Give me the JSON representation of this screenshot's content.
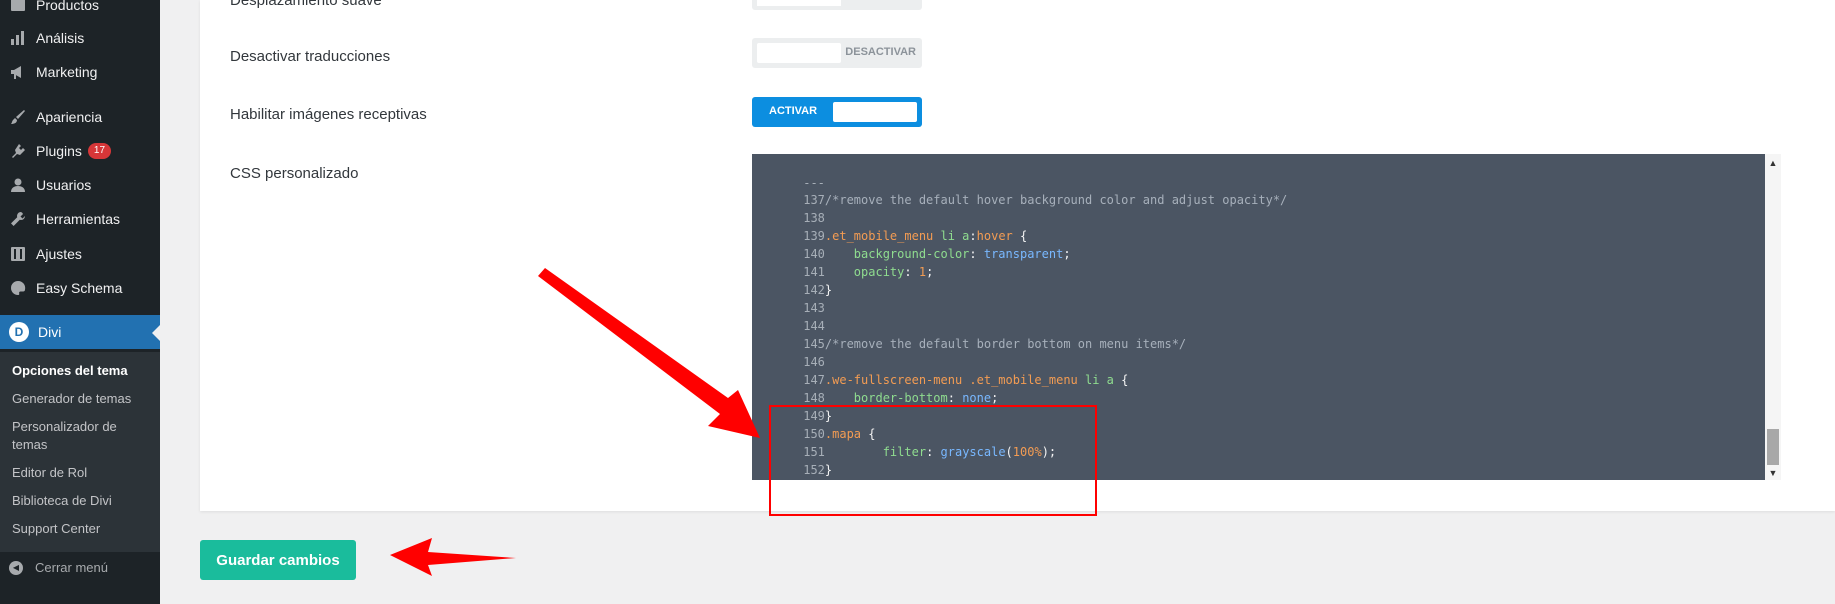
{
  "sidebar": {
    "items": [
      {
        "label": "Productos",
        "icon": "products-icon"
      },
      {
        "label": "Análisis",
        "icon": "analytics-icon"
      },
      {
        "label": "Marketing",
        "icon": "megaphone-icon"
      },
      {
        "label": "Apariencia",
        "icon": "brush-icon"
      },
      {
        "label": "Plugins",
        "icon": "plugin-icon",
        "badge": "17"
      },
      {
        "label": "Usuarios",
        "icon": "users-icon"
      },
      {
        "label": "Herramientas",
        "icon": "wrench-icon"
      },
      {
        "label": "Ajustes",
        "icon": "settings-icon"
      },
      {
        "label": "Easy Schema",
        "icon": "palette-icon"
      },
      {
        "label": "Divi",
        "icon": "divi-icon",
        "logo_letter": "D"
      }
    ],
    "submenu": [
      "Opciones del tema",
      "Generador de temas",
      "Personalizador de temas",
      "Editor de Rol",
      "Biblioteca de Divi",
      "Support Center"
    ],
    "collapse_label": "Cerrar menú"
  },
  "options": {
    "smooth_scroll_label": "Desplazamiento suave",
    "disable_translations_label": "Desactivar traducciones",
    "disable_translations_toggle": "DESACTIVAR",
    "responsive_images_label": "Habilitar imágenes receptivas",
    "responsive_images_toggle": "ACTIVAR",
    "custom_css_label": "CSS personalizado"
  },
  "editor": {
    "fold_marker": "---",
    "lines": [
      {
        "n": "137",
        "text": "/*remove the default hover background color and adjust opacity*/"
      },
      {
        "n": "138",
        "text": ""
      },
      {
        "n": "139",
        "text": ".et_mobile_menu li a:hover {"
      },
      {
        "n": "140",
        "text": "    background-color: transparent;"
      },
      {
        "n": "141",
        "text": "    opacity: 1;"
      },
      {
        "n": "142",
        "text": "}"
      },
      {
        "n": "143",
        "text": ""
      },
      {
        "n": "144",
        "text": ""
      },
      {
        "n": "145",
        "text": "/*remove the default border bottom on menu items*/"
      },
      {
        "n": "146",
        "text": ""
      },
      {
        "n": "147",
        "text": ".we-fullscreen-menu .et_mobile_menu li a {"
      },
      {
        "n": "148",
        "text": "    border-bottom: none;"
      },
      {
        "n": "149",
        "text": "}"
      },
      {
        "n": "150",
        "text": ".mapa {"
      },
      {
        "n": "151",
        "text": "        filter: grayscale(100%);"
      },
      {
        "n": "152",
        "text": "}"
      }
    ]
  },
  "save_button": "Guardar cambios",
  "colors": {
    "sidebar_bg": "#1d2327",
    "active": "#2271b1",
    "toggle_on": "#0c8ee0",
    "save": "#1abc9c",
    "annotation": "#ff0000",
    "editor_bg": "#4b5563"
  }
}
